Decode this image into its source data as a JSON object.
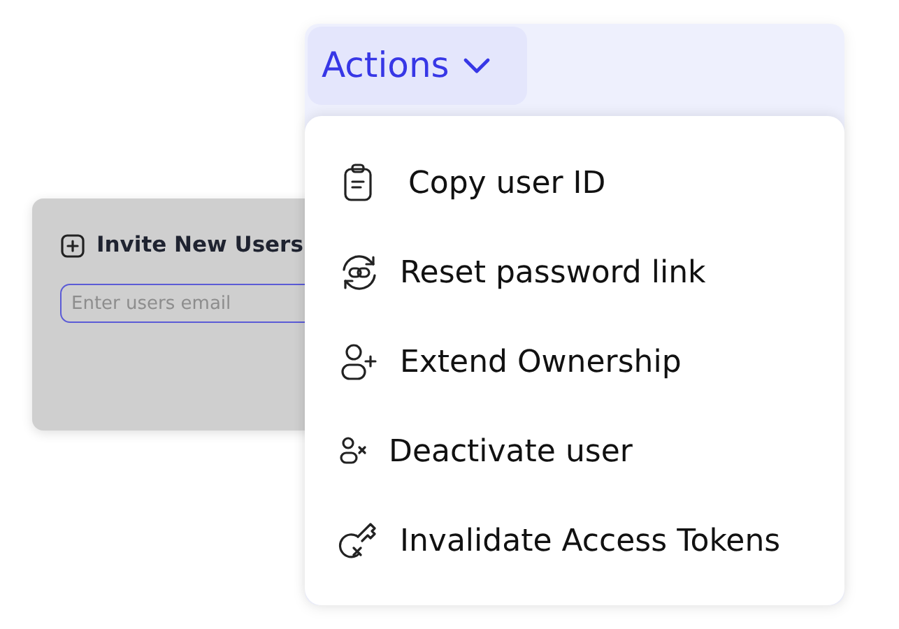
{
  "invite_card": {
    "title": "Invite New Users",
    "email_field": {
      "placeholder": "Enter users email"
    }
  },
  "actions_menu": {
    "button": {
      "label": "Actions",
      "expanded": true
    },
    "items": [
      {
        "label": "Copy user ID",
        "kind": "clipboard"
      },
      {
        "label": "Reset password link",
        "kind": "link-refresh"
      },
      {
        "label": "Extend Ownership",
        "kind": "user-add"
      },
      {
        "label": "Deactivate user",
        "kind": "user-remove"
      },
      {
        "label": "Invalidate Access Tokens",
        "kind": "key-remove"
      }
    ]
  }
}
